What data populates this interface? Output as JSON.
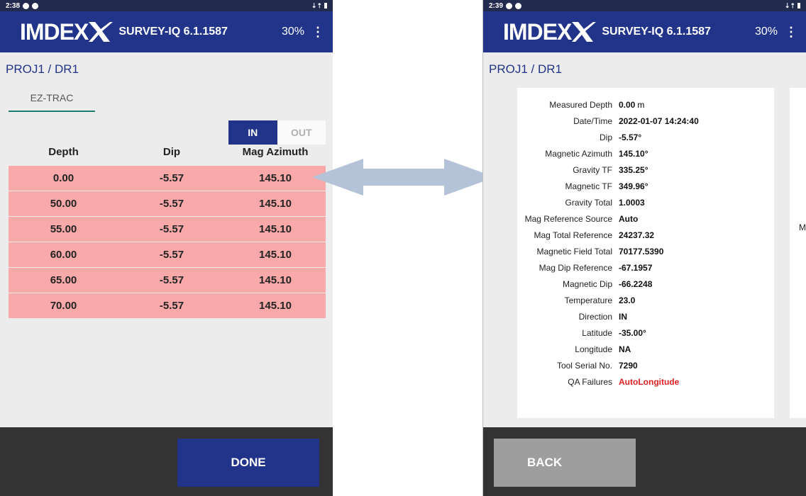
{
  "left": {
    "status_time": "2:38",
    "logo": "IMDEX",
    "app_name": "SURVEY-IQ 6.1.1587",
    "battery": "30%",
    "menu_glyph": "⋮",
    "breadcrumb": "PROJ1 / DR1",
    "tab": "EZ-TRAC",
    "toggle": {
      "in": "IN",
      "out": "OUT"
    },
    "columns": {
      "depth": "Depth",
      "dip": "Dip",
      "mag": "Mag Azimuth"
    },
    "rows": [
      {
        "depth": "0.00",
        "dip": "-5.57",
        "mag": "145.10"
      },
      {
        "depth": "50.00",
        "dip": "-5.57",
        "mag": "145.10"
      },
      {
        "depth": "55.00",
        "dip": "-5.57",
        "mag": "145.10"
      },
      {
        "depth": "60.00",
        "dip": "-5.57",
        "mag": "145.10"
      },
      {
        "depth": "65.00",
        "dip": "-5.57",
        "mag": "145.10"
      },
      {
        "depth": "70.00",
        "dip": "-5.57",
        "mag": "145.10"
      }
    ],
    "done": "DONE"
  },
  "right": {
    "status_time": "2:39",
    "logo": "IMDEX",
    "app_name": "SURVEY-IQ 6.1.1587",
    "battery": "30%",
    "menu_glyph": "⋮",
    "breadcrumb": "PROJ1 / DR1",
    "details": [
      {
        "label": "Measured Depth",
        "value": "0.00",
        "unit": "m"
      },
      {
        "label": "Date/Time",
        "value": "2022-01-07 14:24:40"
      },
      {
        "label": "Dip",
        "value": "-5.57°"
      },
      {
        "label": "Magnetic Azimuth",
        "value": "145.10°"
      },
      {
        "label": "Gravity TF",
        "value": "335.25°"
      },
      {
        "label": "Magnetic TF",
        "value": "349.96°"
      },
      {
        "label": "Gravity Total",
        "value": "1.0003"
      },
      {
        "label": "Mag Reference Source",
        "value": "Auto"
      },
      {
        "label": "Mag Total Reference",
        "value": "24237.32"
      },
      {
        "label": "Magnetic Field Total",
        "value": "70177.5390"
      },
      {
        "label": "Mag Dip Reference",
        "value": "-67.1957"
      },
      {
        "label": "Magnetic Dip",
        "value": "-66.2248"
      },
      {
        "label": "Temperature",
        "value": "23.0"
      },
      {
        "label": "Direction",
        "value": "IN"
      },
      {
        "label": "Latitude",
        "value": "-35.00°"
      },
      {
        "label": "Longitude",
        "value": "NA"
      },
      {
        "label": "Tool Serial No.",
        "value": "7290"
      },
      {
        "label": "QA Failures",
        "value": "AutoLongitude",
        "alert": true
      }
    ],
    "next_card_peek": "M",
    "back": "BACK"
  },
  "colors": {
    "brand_blue": "#22348a",
    "failed_row": "#f9a9a9",
    "qa_failure": "#e02020",
    "arrow": "#b4c3d8"
  }
}
